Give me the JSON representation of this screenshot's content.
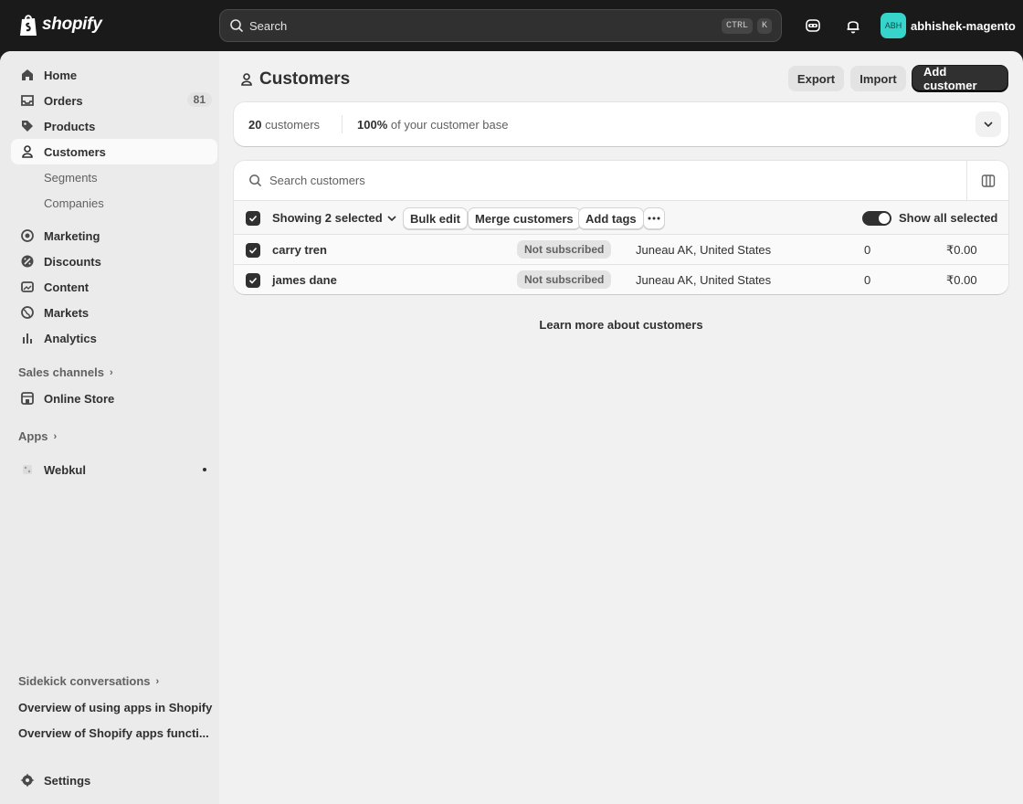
{
  "topbar": {
    "logo_text": "shopify",
    "search_placeholder": "Search",
    "kbd_ctrl": "CTRL",
    "kbd_k": "K",
    "avatar_initials": "ABH",
    "user_name": "abhishek-magento",
    "colors": {
      "avatar_bg": "#37d4cb",
      "bar_bg": "#1a1a1a"
    }
  },
  "sidebar": {
    "items": [
      {
        "label": "Home",
        "icon": "home-icon"
      },
      {
        "label": "Orders",
        "icon": "inbox-icon",
        "badge": "81"
      },
      {
        "label": "Products",
        "icon": "tag-icon"
      },
      {
        "label": "Customers",
        "icon": "person-icon",
        "active": true
      },
      {
        "label": "Segments"
      },
      {
        "label": "Companies"
      },
      {
        "label": "Marketing",
        "icon": "target-icon"
      },
      {
        "label": "Discounts",
        "icon": "discount-icon"
      },
      {
        "label": "Content",
        "icon": "content-icon"
      },
      {
        "label": "Markets",
        "icon": "globe-icon"
      },
      {
        "label": "Analytics",
        "icon": "bar-chart-icon"
      }
    ],
    "sales_channels": "Sales channels",
    "online_store": "Online Store",
    "apps": "Apps",
    "webkul": "Webkul",
    "sidekick": "Sidekick conversations",
    "conversations": [
      "Overview of using apps in Shopify",
      "Overview of Shopify apps functi..."
    ],
    "settings": "Settings"
  },
  "main": {
    "title": "Customers",
    "export_label": "Export",
    "import_label": "Import",
    "add_label": "Add customer",
    "stats": {
      "count_num": "20",
      "count_label": "customers",
      "base_num": "100%",
      "base_label": "of your customer base"
    },
    "search_placeholder": "Search customers",
    "bulk": {
      "showing": "Showing 2 selected",
      "bulk_edit": "Bulk edit",
      "merge": "Merge customers",
      "add_tags": "Add tags",
      "show_all": "Show all selected"
    },
    "rows": [
      {
        "name": "carry tren",
        "subscription": "Not subscribed",
        "location": "Juneau AK, United States",
        "orders": "0",
        "spent": "₹0.00"
      },
      {
        "name": "james dane",
        "subscription": "Not subscribed",
        "location": "Juneau AK, United States",
        "orders": "0",
        "spent": "₹0.00"
      }
    ],
    "learn_more": "Learn more about customers"
  }
}
